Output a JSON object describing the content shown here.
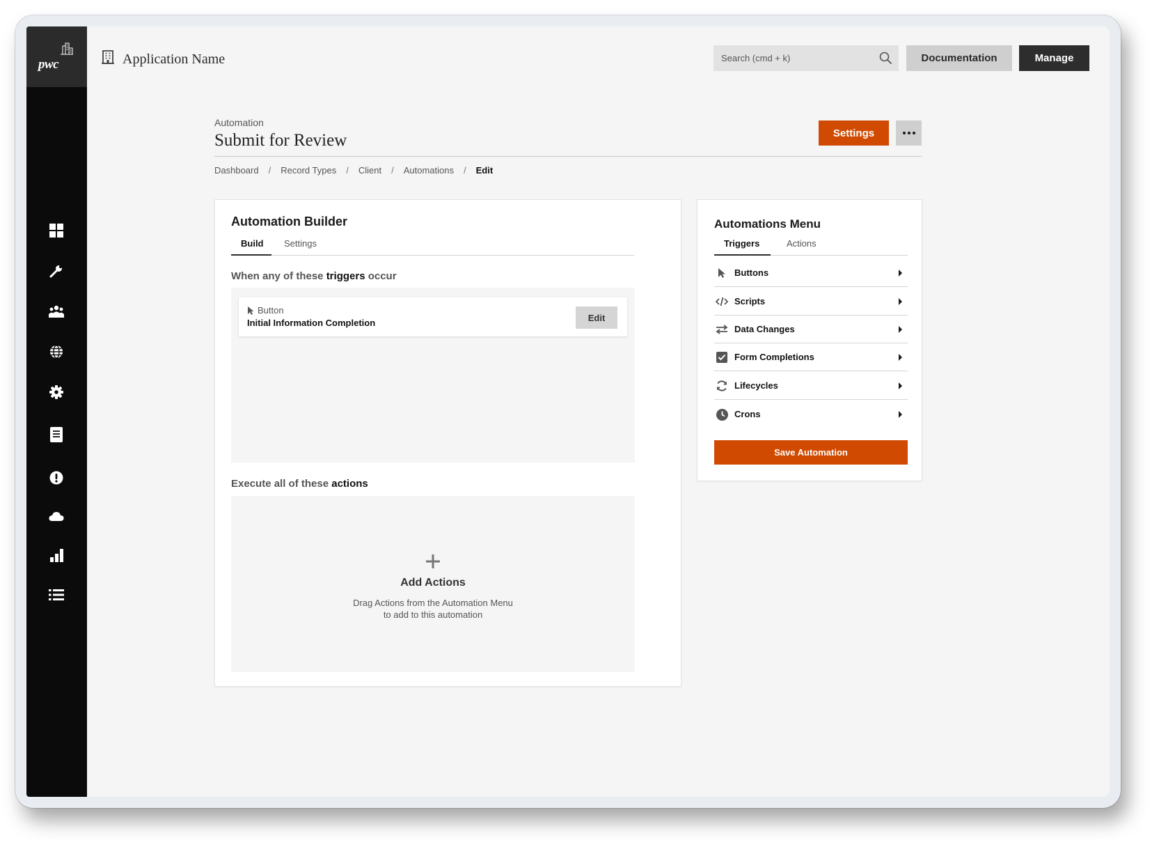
{
  "app": {
    "logo_text": "pwc",
    "name": "Application Name"
  },
  "topbar": {
    "search_placeholder": "Search (cmd + k)",
    "documentation_label": "Documentation",
    "manage_label": "Manage"
  },
  "sidebar": {
    "items": [
      {
        "icon": "dashboard-grid-icon"
      },
      {
        "icon": "wrench-icon"
      },
      {
        "icon": "users-icon"
      },
      {
        "icon": "globe-icon"
      },
      {
        "icon": "gear-icon"
      },
      {
        "icon": "document-icon"
      },
      {
        "icon": "alert-icon"
      },
      {
        "icon": "cloud-icon"
      },
      {
        "icon": "bar-chart-icon"
      },
      {
        "icon": "list-icon"
      }
    ]
  },
  "page": {
    "kicker": "Automation",
    "title": "Submit for Review",
    "settings_label": "Settings",
    "breadcrumb": [
      "Dashboard",
      "Record Types",
      "Client",
      "Automations",
      "Edit"
    ]
  },
  "builder": {
    "title": "Automation Builder",
    "tabs": [
      {
        "label": "Build",
        "active": true
      },
      {
        "label": "Settings",
        "active": false
      }
    ],
    "triggers_heading_pre": "When any of these ",
    "triggers_heading_bold": "triggers",
    "triggers_heading_post": " occur",
    "trigger": {
      "type": "Button",
      "name": "Initial Information Completion",
      "edit_label": "Edit"
    },
    "actions_heading_pre": "Execute all of these ",
    "actions_heading_bold": "actions",
    "add_title": "Add Actions",
    "add_desc_line1": "Drag Actions from the Automation Menu",
    "add_desc_line2": "to add to this automation"
  },
  "menu": {
    "title": "Automations Menu",
    "tabs": [
      {
        "label": "Triggers",
        "active": true
      },
      {
        "label": "Actions",
        "active": false
      }
    ],
    "items": [
      {
        "label": "Buttons",
        "icon": "cursor-icon"
      },
      {
        "label": "Scripts",
        "icon": "code-icon"
      },
      {
        "label": "Data Changes",
        "icon": "swap-arrows-icon"
      },
      {
        "label": "Form Completions",
        "icon": "checkbox-icon"
      },
      {
        "label": "Lifecycles",
        "icon": "refresh-icon"
      },
      {
        "label": "Crons",
        "icon": "clock-icon"
      }
    ],
    "save_label": "Save Automation"
  },
  "colors": {
    "accent": "#d04a02",
    "sidebar": "#0b0b0b",
    "dark_button": "#2d2d2d"
  }
}
